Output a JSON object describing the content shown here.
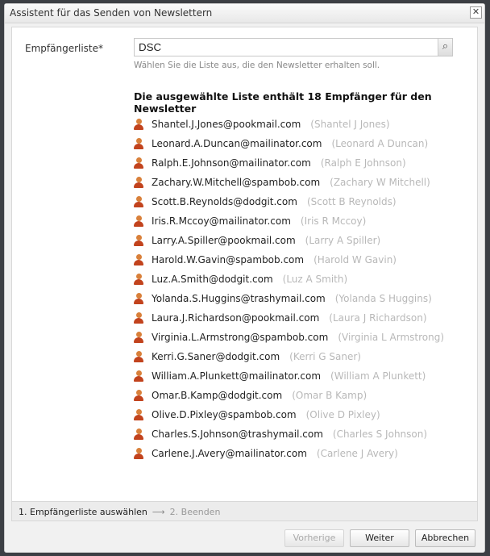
{
  "dialog": {
    "title": "Assistent für das Senden von Newslettern",
    "close_label": "✕"
  },
  "form": {
    "label": "Empfängerliste*",
    "value": "DSC",
    "hint": "Wählen Sie die Liste aus, die den Newsletter erhalten soll."
  },
  "heading": "Die ausgewählte Liste enthält 18 Empfänger für den Newsletter",
  "recipients": [
    {
      "email": "Shantel.J.Jones@pookmail.com",
      "name": "(Shantel J Jones)"
    },
    {
      "email": "Leonard.A.Duncan@mailinator.com",
      "name": "(Leonard A Duncan)"
    },
    {
      "email": "Ralph.E.Johnson@mailinator.com",
      "name": "(Ralph E Johnson)"
    },
    {
      "email": "Zachary.W.Mitchell@spambob.com",
      "name": "(Zachary W Mitchell)"
    },
    {
      "email": "Scott.B.Reynolds@dodgit.com",
      "name": "(Scott B Reynolds)"
    },
    {
      "email": "Iris.R.Mccoy@mailinator.com",
      "name": "(Iris R Mccoy)"
    },
    {
      "email": "Larry.A.Spiller@pookmail.com",
      "name": "(Larry A Spiller)"
    },
    {
      "email": "Harold.W.Gavin@spambob.com",
      "name": "(Harold W Gavin)"
    },
    {
      "email": "Luz.A.Smith@dodgit.com",
      "name": "(Luz A Smith)"
    },
    {
      "email": "Yolanda.S.Huggins@trashymail.com",
      "name": "(Yolanda S Huggins)"
    },
    {
      "email": "Laura.J.Richardson@pookmail.com",
      "name": "(Laura J Richardson)"
    },
    {
      "email": "Virginia.L.Armstrong@spambob.com",
      "name": "(Virginia L Armstrong)"
    },
    {
      "email": "Kerri.G.Saner@dodgit.com",
      "name": "(Kerri G Saner)"
    },
    {
      "email": "William.A.Plunkett@mailinator.com",
      "name": "(William A Plunkett)"
    },
    {
      "email": "Omar.B.Kamp@dodgit.com",
      "name": "(Omar B Kamp)"
    },
    {
      "email": "Olive.D.Pixley@spambob.com",
      "name": "(Olive D Pixley)"
    },
    {
      "email": "Charles.S.Johnson@trashymail.com",
      "name": "(Charles S Johnson)"
    },
    {
      "email": "Carlene.J.Avery@mailinator.com",
      "name": "(Carlene J Avery)"
    }
  ],
  "steps": {
    "step1": "1. Empfängerliste auswählen",
    "arrow": "⟶",
    "step2": "2. Beenden"
  },
  "buttons": {
    "previous": "Vorherige",
    "next": "Weiter",
    "cancel": "Abbrechen"
  }
}
